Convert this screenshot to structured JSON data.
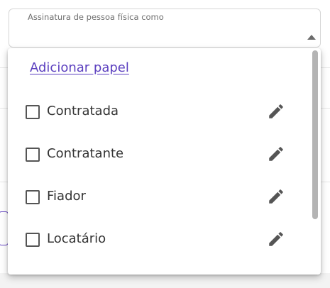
{
  "select": {
    "label": "Assinatura de pessoa física como",
    "caret_icon": "caret-up-icon"
  },
  "dropdown": {
    "add_role_link": "Adicionar papel",
    "options": [
      {
        "label": "Contratada",
        "checked": false,
        "edit_icon": "pencil-icon"
      },
      {
        "label": "Contratante",
        "checked": false,
        "edit_icon": "pencil-icon"
      },
      {
        "label": "Fiador",
        "checked": false,
        "edit_icon": "pencil-icon"
      },
      {
        "label": "Locatário",
        "checked": false,
        "edit_icon": "pencil-icon"
      }
    ]
  },
  "colors": {
    "link": "#5b3fbf",
    "icon": "#555555",
    "scrollbar": "#b4b4b4"
  }
}
